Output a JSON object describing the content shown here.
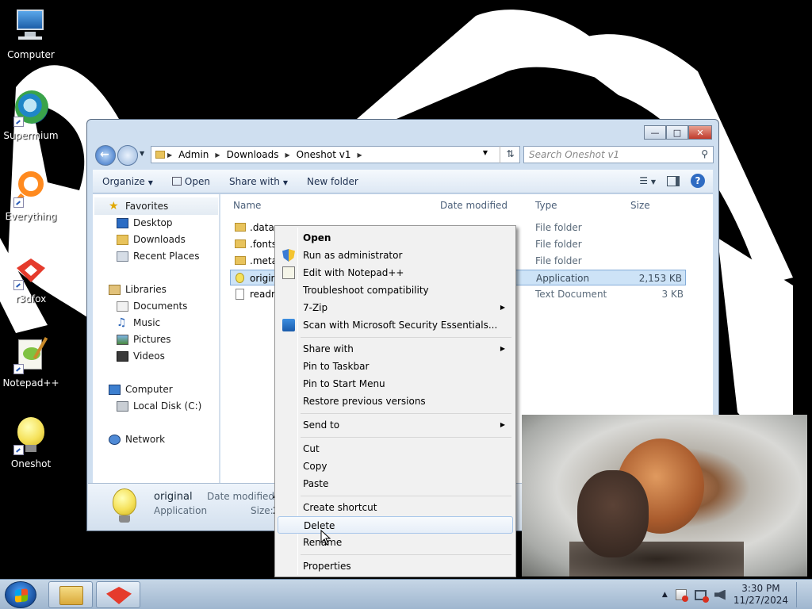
{
  "desktop": {
    "icons": [
      {
        "label": "Computer"
      },
      {
        "label": "Supermium"
      },
      {
        "label": "Everything"
      },
      {
        "label": "r3dfox"
      },
      {
        "label": "Notepad++"
      },
      {
        "label": "Oneshot"
      }
    ]
  },
  "explorer": {
    "breadcrumb": [
      "Admin",
      "Downloads",
      "Oneshot v1"
    ],
    "search_placeholder": "Search Oneshot v1",
    "toolbar": {
      "organize": "Organize",
      "open": "Open",
      "share_with": "Share with",
      "new_folder": "New folder"
    },
    "nav": {
      "favorites": "Favorites",
      "desktop": "Desktop",
      "downloads": "Downloads",
      "recent_places": "Recent Places",
      "libraries": "Libraries",
      "documents": "Documents",
      "music": "Music",
      "pictures": "Pictures",
      "videos": "Videos",
      "computer": "Computer",
      "local_disk": "Local Disk (C:)",
      "network": "Network"
    },
    "columns": {
      "name": "Name",
      "date_modified": "Date modified",
      "type": "Type",
      "size": "Size"
    },
    "files": [
      {
        "name": ".data",
        "type": "File folder",
        "size": ""
      },
      {
        "name": ".fonts",
        "type": "File folder",
        "size": ""
      },
      {
        "name": ".meta",
        "type": "File folder",
        "size": ""
      },
      {
        "name": "original",
        "type": "Application",
        "size": "2,153 KB"
      },
      {
        "name": "readm",
        "type": "Text Document",
        "size": "3 KB"
      }
    ],
    "details": {
      "name": "original",
      "type": "Application",
      "date_modified_label": "Date modified:",
      "date_modified_value": "4",
      "size_label": "Size:",
      "size_value": "2"
    }
  },
  "context_menu": {
    "items": [
      {
        "label": "Open"
      },
      {
        "label": "Run as administrator"
      },
      {
        "label": "Edit with Notepad++"
      },
      {
        "label": "Troubleshoot compatibility"
      },
      {
        "label": "7-Zip"
      },
      {
        "label": "Scan with Microsoft Security Essentials..."
      },
      {
        "label": "Share with"
      },
      {
        "label": "Pin to Taskbar"
      },
      {
        "label": "Pin to Start Menu"
      },
      {
        "label": "Restore previous versions"
      },
      {
        "label": "Send to"
      },
      {
        "label": "Cut"
      },
      {
        "label": "Copy"
      },
      {
        "label": "Paste"
      },
      {
        "label": "Create shortcut"
      },
      {
        "label": "Delete"
      },
      {
        "label": "Rename"
      },
      {
        "label": "Properties"
      }
    ]
  },
  "taskbar": {
    "time": "3:30 PM",
    "date": "11/27/2024"
  }
}
